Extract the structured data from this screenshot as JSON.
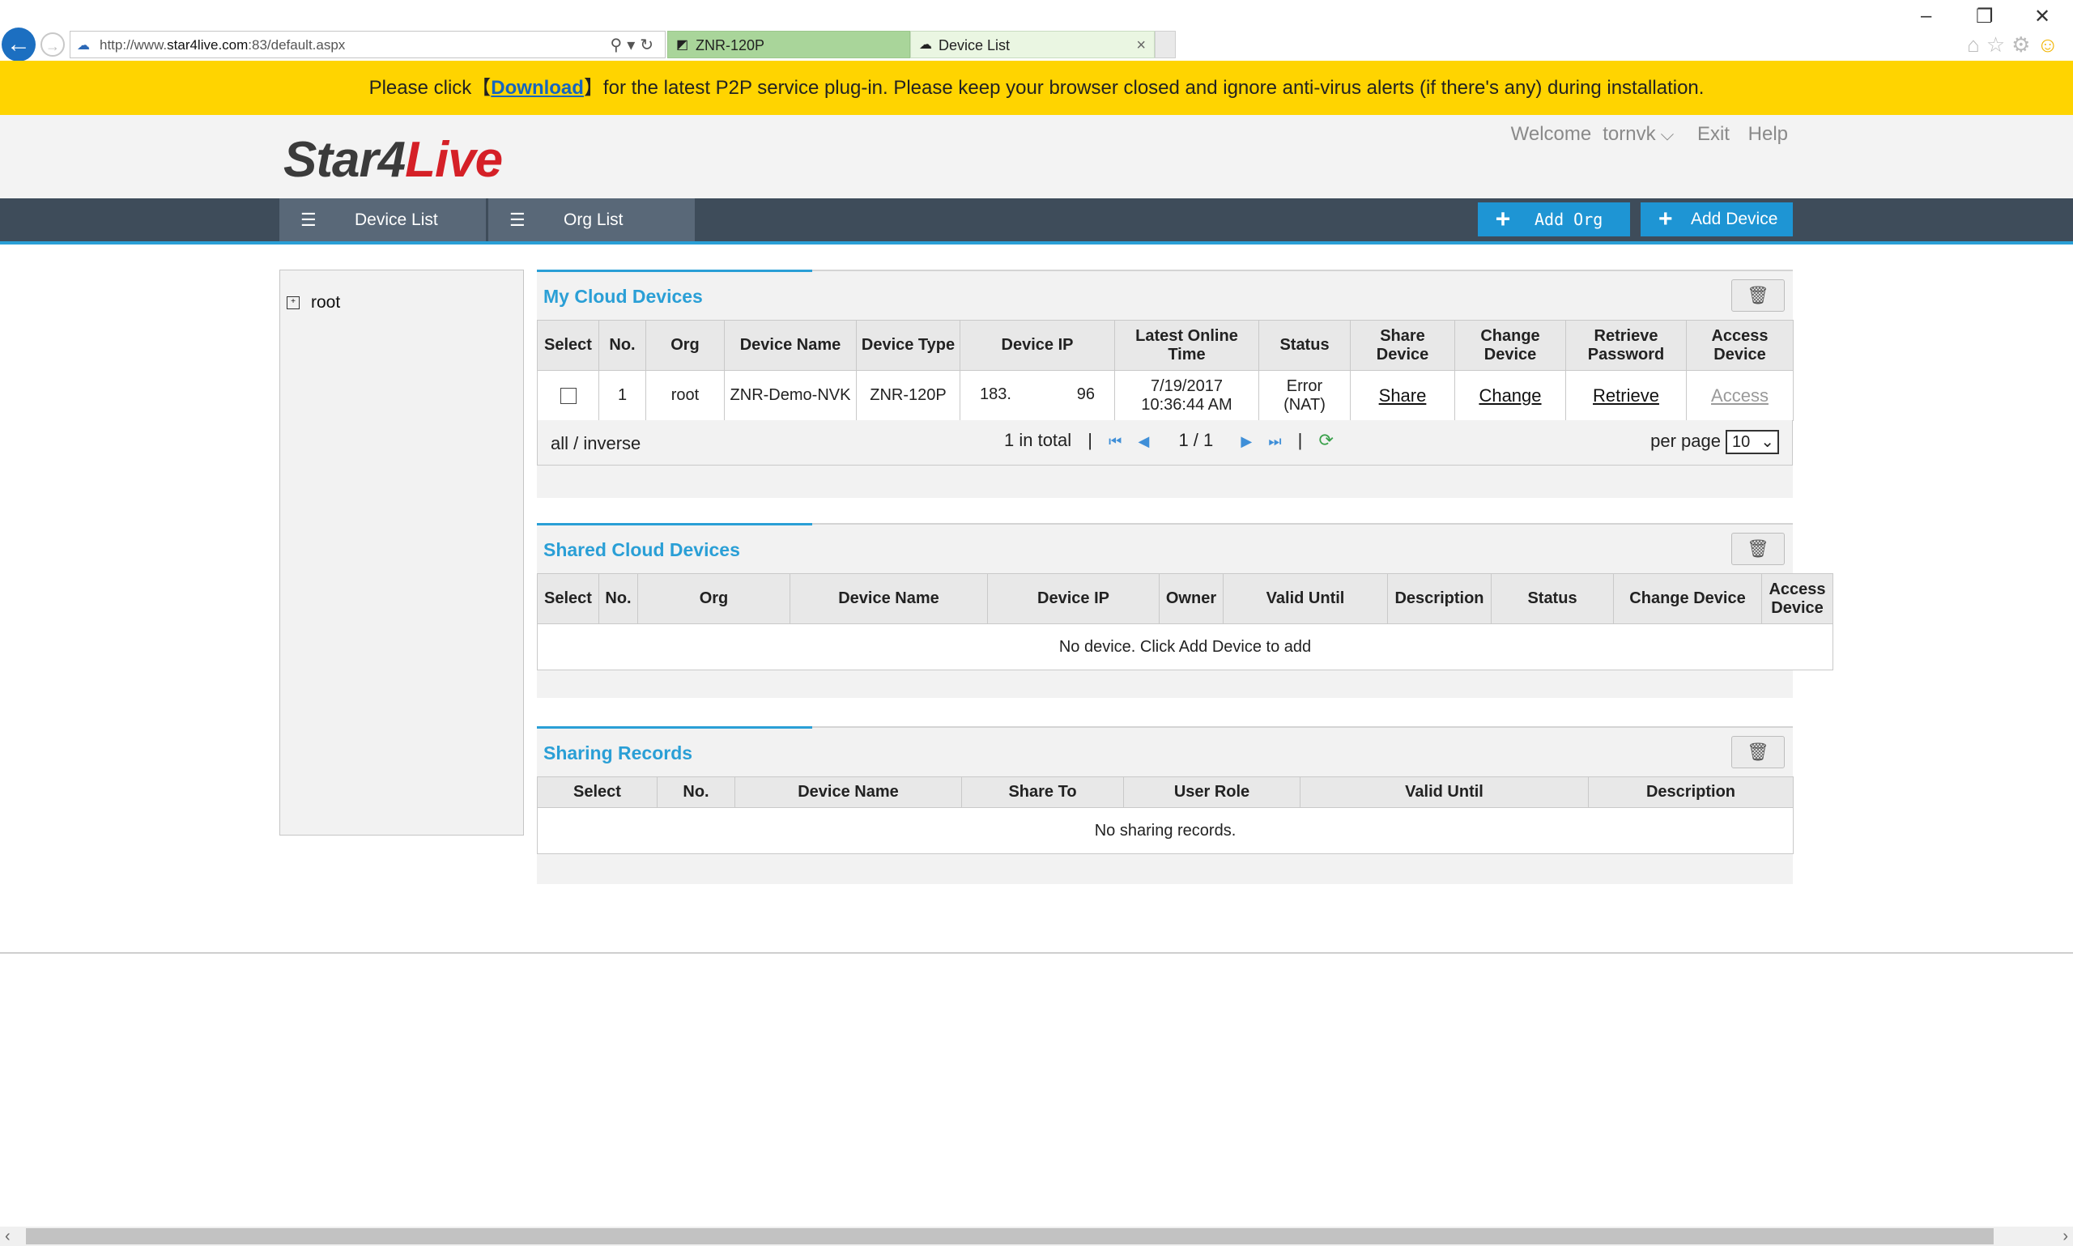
{
  "browser": {
    "url_prefix": "http://www.",
    "url_domain": "star4live.com",
    "url_suffix": ":83/default.aspx",
    "tabs": [
      {
        "label": "ZNR-120P"
      },
      {
        "label": "Device List"
      }
    ],
    "window_controls": {
      "minimize": "–",
      "restore": "❐",
      "close": "✕"
    }
  },
  "banner": {
    "before": "Please click【",
    "link": "Download",
    "after": "】for the latest P2P service plug-in. Please keep your browser closed and ignore anti-virus alerts (if there's any) during installation."
  },
  "header": {
    "logo_part1": "Star4",
    "logo_part2": "Live",
    "welcome": "Welcome",
    "username": "tornvk",
    "exit": "Exit",
    "help": "Help"
  },
  "nav": {
    "tabs": [
      {
        "label": "Device List"
      },
      {
        "label": "Org List"
      }
    ],
    "add_org": "Add Org",
    "add_device": "Add Device"
  },
  "tree": {
    "root_label": "root",
    "expand_symbol": "+"
  },
  "my_cloud": {
    "title": "My Cloud Devices",
    "columns": [
      "Select",
      "No.",
      "Org",
      "Device Name",
      "Device Type",
      "Device IP",
      "Latest Online Time",
      "Status",
      "Share Device",
      "Change Device",
      "Retrieve Password",
      "Access Device"
    ],
    "rows": [
      {
        "no": "1",
        "org": "root",
        "device_name": "ZNR-Demo-NVK",
        "device_type": "ZNR-120P",
        "ip_start": "183.",
        "ip_end": "96",
        "online_date": "7/19/2017",
        "online_time": "10:36:44 AM",
        "status_line1": "Error",
        "status_line2": "(NAT)",
        "share": "Share",
        "change": "Change",
        "retrieve": "Retrieve",
        "access": "Access"
      }
    ],
    "pager": {
      "all_inverse": "all / inverse",
      "total": "1 in total",
      "page": "1 / 1",
      "per_page_label": "per page",
      "per_page_value": "10"
    }
  },
  "shared_cloud": {
    "title": "Shared Cloud Devices",
    "columns": [
      "Select",
      "No.",
      "Org",
      "Device Name",
      "Device IP",
      "Owner",
      "Valid Until",
      "Description",
      "Status",
      "Change Device",
      "Access Device"
    ],
    "empty_message": "No device. Click Add Device to add"
  },
  "sharing_records": {
    "title": "Sharing Records",
    "columns": [
      "Select",
      "No.",
      "Device Name",
      "Share To",
      "User Role",
      "Valid Until",
      "Description"
    ],
    "empty_message": "No sharing records."
  }
}
